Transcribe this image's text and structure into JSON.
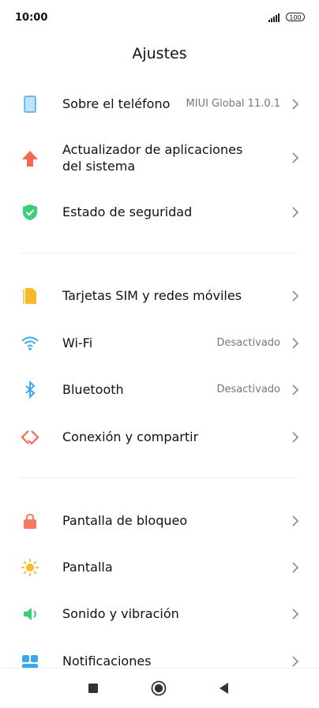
{
  "status_bar": {
    "time": "10:00",
    "battery": "100"
  },
  "title": "Ajustes",
  "items": [
    {
      "label": "Sobre el teléfono",
      "value": "MIUI Global 11.0.1",
      "icon": "phone-icon",
      "color": "#4aa8e8"
    },
    {
      "label": "Actualizador de aplicaciones",
      "label2": "del sistema",
      "value": "",
      "icon": "update-arrow-icon",
      "color": "#f26b50"
    },
    {
      "label": "Estado de seguridad",
      "value": "",
      "icon": "shield-check-icon",
      "color": "#3ccf7a"
    },
    {
      "label": "Tarjetas SIM y redes móviles",
      "value": "",
      "icon": "sim-card-icon",
      "color": "#f6b92b"
    },
    {
      "label": "Wi-Fi",
      "value": "Desactivado",
      "icon": "wifi-icon",
      "color": "#3aa7f0"
    },
    {
      "label": "Bluetooth",
      "value": "Desactivado",
      "icon": "bluetooth-icon",
      "color": "#3aa7f0"
    },
    {
      "label": "Conexión y compartir",
      "value": "",
      "icon": "connection-share-icon",
      "color": "#f26b50"
    },
    {
      "label": "Pantalla de bloqueo",
      "value": "",
      "icon": "lock-icon",
      "color": "#f47a62"
    },
    {
      "label": "Pantalla",
      "value": "",
      "icon": "brightness-sun-icon",
      "color": "#f6b92b"
    },
    {
      "label": "Sonido y vibración",
      "value": "",
      "icon": "speaker-icon",
      "color": "#3ccf7a"
    },
    {
      "label": "Notificaciones",
      "value": "",
      "icon": "notifications-icon",
      "color": "#3aa7f0"
    }
  ],
  "nav": {
    "recents": "recents-square-icon",
    "home": "home-circle-icon",
    "back": "back-triangle-icon"
  }
}
